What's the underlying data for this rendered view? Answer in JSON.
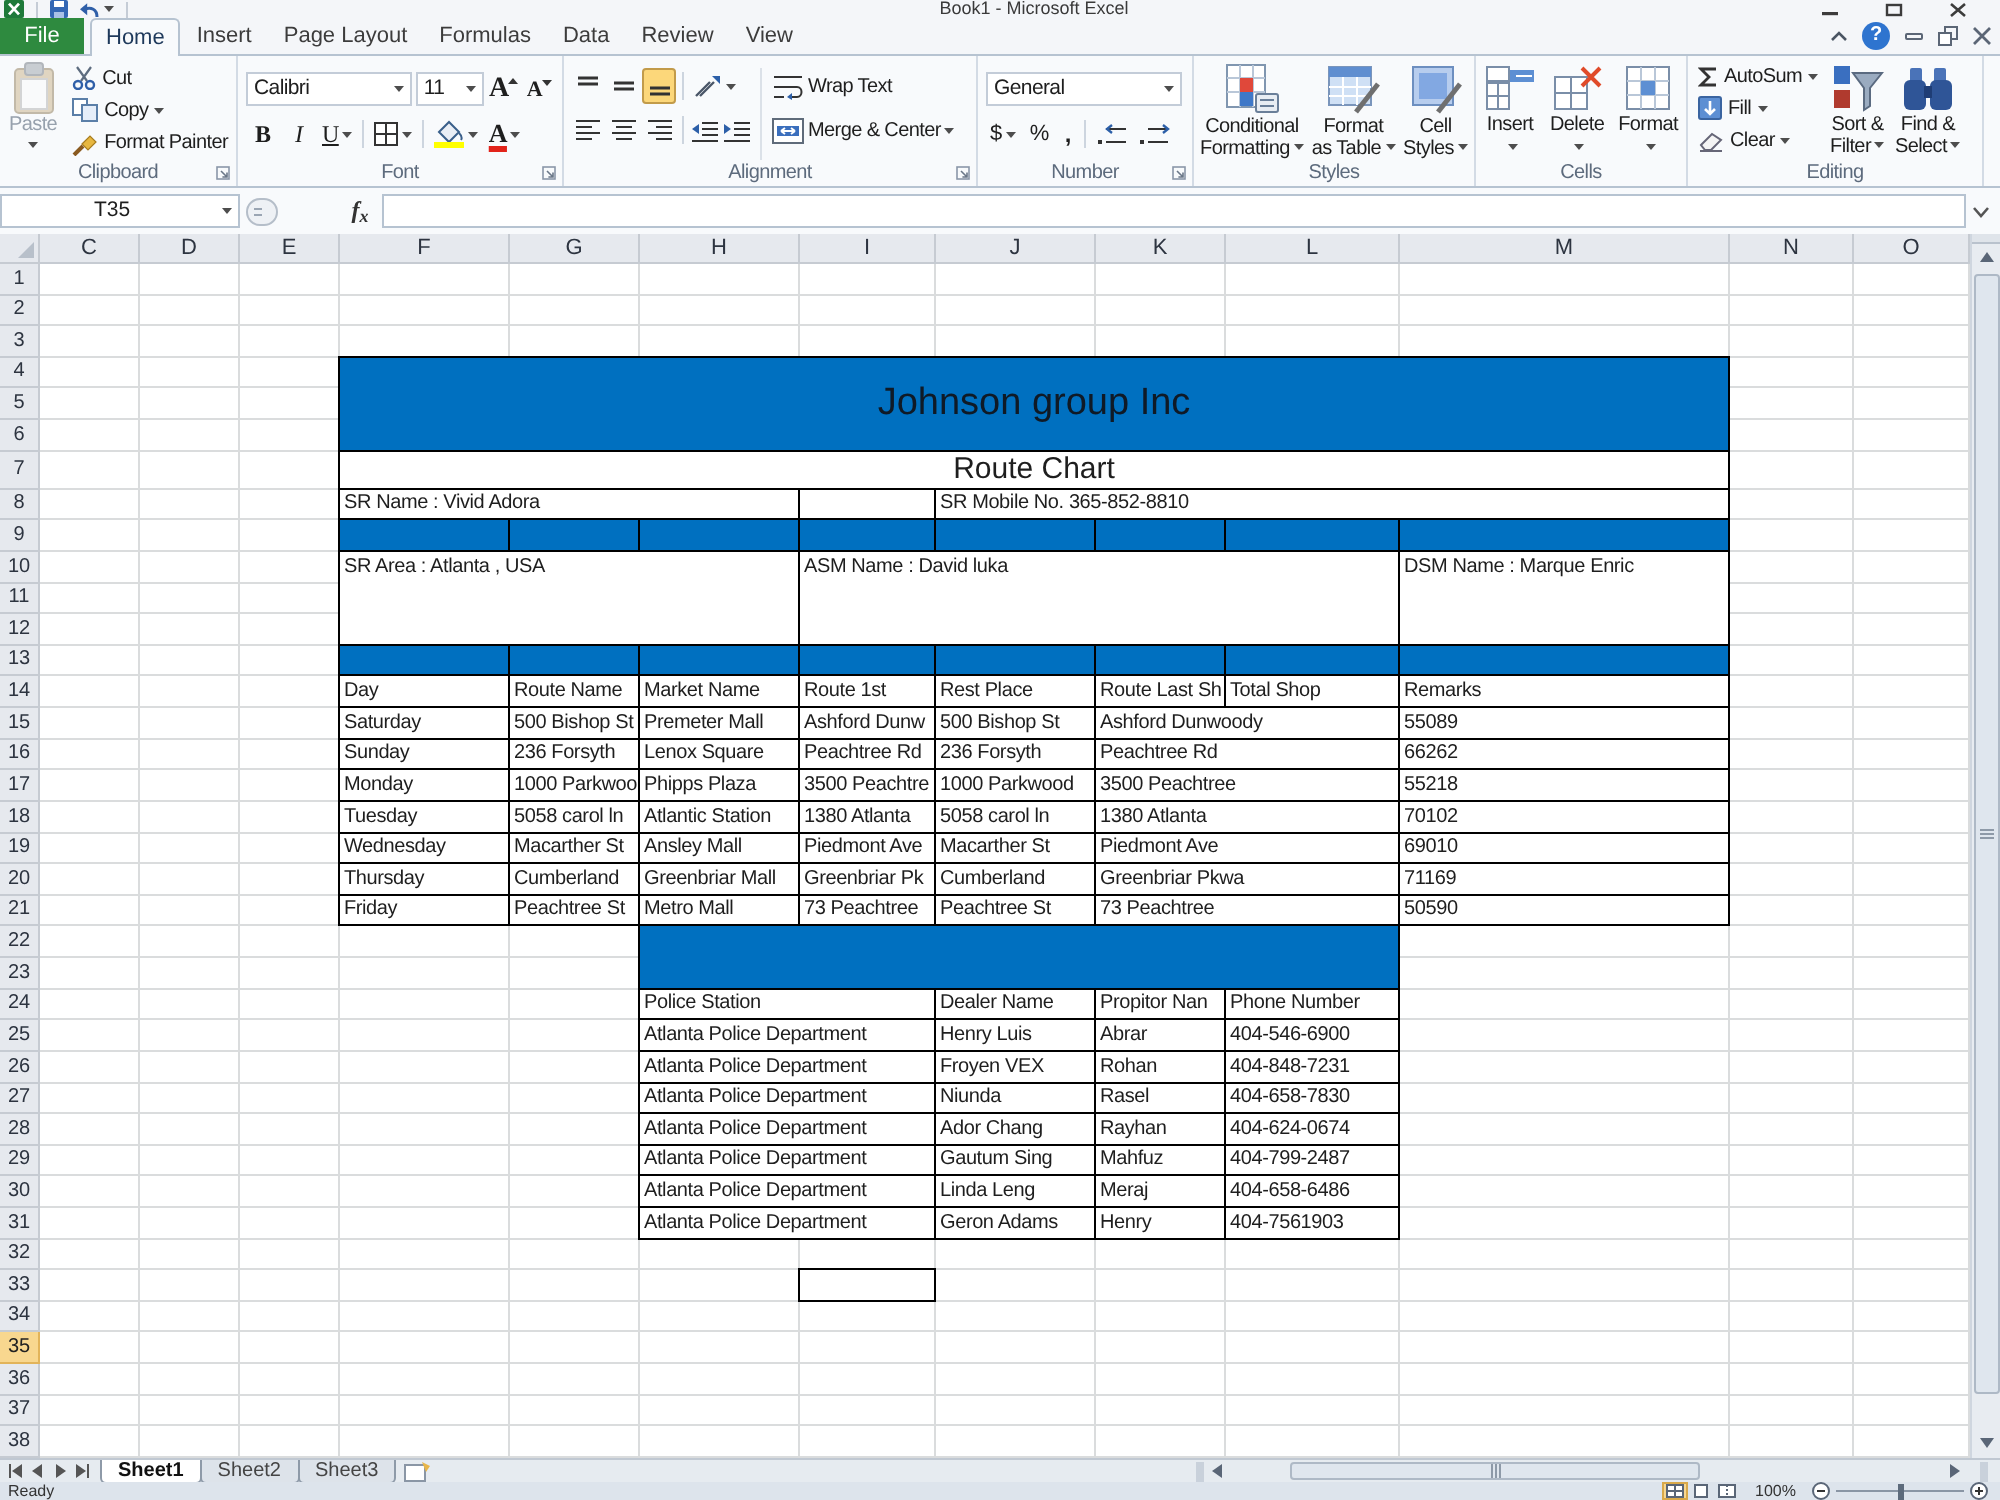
{
  "window": {
    "title": "Book1 - Microsoft Excel"
  },
  "ribbon_tabs": [
    {
      "label": "File",
      "kind": "file",
      "selected": false
    },
    {
      "label": "Home",
      "kind": "tab",
      "selected": true
    },
    {
      "label": "Insert",
      "kind": "tab",
      "selected": false
    },
    {
      "label": "Page Layout",
      "kind": "tab",
      "selected": false
    },
    {
      "label": "Formulas",
      "kind": "tab",
      "selected": false
    },
    {
      "label": "Data",
      "kind": "tab",
      "selected": false
    },
    {
      "label": "Review",
      "kind": "tab",
      "selected": false
    },
    {
      "label": "View",
      "kind": "tab",
      "selected": false
    }
  ],
  "help": "?",
  "ribbon": {
    "clipboard": {
      "label": "Clipboard",
      "paste": {
        "label": "Paste",
        "disabled": true
      },
      "cut": "Cut",
      "copy": "Copy",
      "format_painter": "Format Painter"
    },
    "font": {
      "label": "Font",
      "font_name": "Calibri",
      "font_size": "11",
      "grow": "A",
      "shrink": "A",
      "bold": "B",
      "italic": "I",
      "underline": "U",
      "font_color": "A"
    },
    "alignment": {
      "label": "Alignment",
      "vertical": [
        {
          "kind": "top",
          "selected": false
        },
        {
          "kind": "middle",
          "selected": false
        },
        {
          "kind": "bottom",
          "selected": true
        }
      ],
      "horizontal": [
        {
          "kind": "left",
          "selected": false
        },
        {
          "kind": "center",
          "selected": false
        },
        {
          "kind": "right",
          "selected": false
        }
      ],
      "wrap_text": "Wrap Text",
      "merge_center": "Merge & Center"
    },
    "number": {
      "label": "Number",
      "format": "General",
      "currency": "$",
      "percent": "%",
      "comma": ","
    },
    "styles": {
      "label": "Styles",
      "buttons": [
        {
          "kind": "conditional",
          "lines": [
            "Conditional",
            "Formatting"
          ]
        },
        {
          "kind": "table",
          "lines": [
            "Format",
            "as Table"
          ]
        },
        {
          "kind": "cell_styles",
          "lines": [
            "Cell",
            "Styles"
          ]
        }
      ]
    },
    "cells": {
      "label": "Cells",
      "buttons": [
        {
          "kind": "insert",
          "label": "Insert"
        },
        {
          "kind": "delete",
          "label": "Delete"
        },
        {
          "kind": "format",
          "label": "Format"
        }
      ]
    },
    "editing": {
      "label": "Editing",
      "autosum": "AutoSum",
      "fill": "Fill",
      "clear": "Clear",
      "sort_filter": [
        "Sort &",
        "Filter"
      ],
      "find_select": [
        "Find &",
        "Select"
      ]
    }
  },
  "formula_bar": {
    "name_box": "T35",
    "insert_function": "f$_{x}$"
  },
  "sheet": {
    "columns": [
      {
        "label": "C",
        "selected": false
      },
      {
        "label": "D",
        "selected": false
      },
      {
        "label": "E",
        "selected": false
      },
      {
        "label": "F",
        "selected": false
      },
      {
        "label": "G",
        "selected": false
      },
      {
        "label": "H",
        "selected": false
      },
      {
        "label": "I",
        "selected": false
      },
      {
        "label": "J",
        "selected": false
      },
      {
        "label": "K",
        "selected": false
      },
      {
        "label": "L",
        "selected": false
      },
      {
        "label": "M",
        "selected": false
      },
      {
        "label": "N",
        "selected": false
      },
      {
        "label": "O",
        "selected": false
      }
    ],
    "rows": [
      {
        "label": "1",
        "selected": false
      },
      {
        "label": "2",
        "selected": false
      },
      {
        "label": "3",
        "selected": false
      },
      {
        "label": "4",
        "selected": false
      },
      {
        "label": "5",
        "selected": false
      },
      {
        "label": "6",
        "selected": false
      },
      {
        "label": "7",
        "selected": false
      },
      {
        "label": "8",
        "selected": false
      },
      {
        "label": "9",
        "selected": false
      },
      {
        "label": "10",
        "selected": false
      },
      {
        "label": "11",
        "selected": false
      },
      {
        "label": "12",
        "selected": false
      },
      {
        "label": "13",
        "selected": false
      },
      {
        "label": "14",
        "selected": false
      },
      {
        "label": "15",
        "selected": false
      },
      {
        "label": "16",
        "selected": false
      },
      {
        "label": "17",
        "selected": false
      },
      {
        "label": "18",
        "selected": false
      },
      {
        "label": "19",
        "selected": false
      },
      {
        "label": "20",
        "selected": false
      },
      {
        "label": "21",
        "selected": false
      },
      {
        "label": "22",
        "selected": false
      },
      {
        "label": "23",
        "selected": false
      },
      {
        "label": "24",
        "selected": false
      },
      {
        "label": "25",
        "selected": false
      },
      {
        "label": "26",
        "selected": false
      },
      {
        "label": "27",
        "selected": false
      },
      {
        "label": "28",
        "selected": false
      },
      {
        "label": "29",
        "selected": false
      },
      {
        "label": "30",
        "selected": false
      },
      {
        "label": "31",
        "selected": false
      },
      {
        "label": "32",
        "selected": false
      },
      {
        "label": "33",
        "selected": false
      },
      {
        "label": "34",
        "selected": false
      },
      {
        "label": "35",
        "selected": true
      },
      {
        "label": "36",
        "selected": false
      },
      {
        "label": "37",
        "selected": false
      },
      {
        "label": "38",
        "selected": false
      }
    ],
    "company": "Johnson group Inc",
    "chart_title": "Route Chart",
    "sr_name": "SR Name : Vivid Adora",
    "sr_mobile": "SR Mobile No. 365-852-8810",
    "sr_area": "SR Area : Atlanta , USA",
    "asm_name": "ASM Name : David luka",
    "dsm_name": "DSM Name : Marque Enric",
    "route_table": {
      "columns": [
        "Day",
        "Route Name",
        "Market Name",
        "Route 1st",
        "Rest Place",
        "Route Last Sh",
        "Total Shop",
        "Remarks"
      ],
      "rows": [
        [
          "Saturday",
          "500 Bishop St",
          "Premeter Mall",
          "Ashford Dunw",
          "500 Bishop St",
          "Ashford Dunwoody",
          "55089"
        ],
        [
          "Sunday",
          "236 Forsyth",
          "Lenox Square",
          "Peachtree Rd",
          "236 Forsyth",
          "Peachtree Rd",
          "66262"
        ],
        [
          "Monday",
          "1000 Parkwoo",
          "Phipps Plaza",
          "3500 Peachtre",
          "1000 Parkwood",
          "3500 Peachtree",
          "55218"
        ],
        [
          "Tuesday",
          "5058 carol ln",
          "Atlantic Station",
          "1380 Atlanta",
          "5058 carol ln",
          "1380 Atlanta",
          "70102"
        ],
        [
          "Wednesday",
          "Macarther St",
          "Ansley Mall",
          "Piedmont Ave",
          "Macarther St",
          "Piedmont Ave",
          "69010"
        ],
        [
          "Thursday",
          "Cumberland",
          "Greenbriar Mall",
          "Greenbriar Pk",
          "Cumberland",
          "Greenbriar Pkwa",
          "71169"
        ],
        [
          "Friday",
          "Peachtree St",
          "Metro Mall",
          "73 Peachtree",
          "Peachtree St",
          "73 Peachtree",
          "50590"
        ]
      ]
    },
    "dealer_table": {
      "columns": [
        "Police Station",
        "Dealer Name",
        "Propitor Nan",
        "Phone Number"
      ],
      "rows": [
        [
          "Atlanta Police Department",
          "Henry Luis",
          "Abrar",
          "404-546-6900"
        ],
        [
          "Atlanta Police Department",
          "Froyen VEX",
          "Rohan",
          "404-848-7231"
        ],
        [
          "Atlanta Police Department",
          "Niunda",
          "Rasel",
          "404-658-7830"
        ],
        [
          "Atlanta Police Department",
          "Ador Chang",
          "Rayhan",
          "404-624-0674"
        ],
        [
          "Atlanta Police Department",
          "Gautum Sing",
          "Mahfuz",
          "404-799-2487"
        ],
        [
          "Atlanta Police Department",
          "Linda Leng",
          "Meraj",
          "404-658-6486"
        ],
        [
          "Atlanta Police Department",
          "Geron Adams",
          "Henry",
          "404-7561903"
        ]
      ]
    }
  },
  "sheet_tabs": [
    {
      "label": "Sheet1",
      "selected": true
    },
    {
      "label": "Sheet2",
      "selected": false
    },
    {
      "label": "Sheet3",
      "selected": false
    }
  ],
  "status_bar": {
    "status": "Ready",
    "views": [
      {
        "kind": "normal",
        "selected": true
      },
      {
        "kind": "page_layout",
        "selected": false
      },
      {
        "kind": "page_break",
        "selected": false
      }
    ],
    "zoom": "100%",
    "zoom_slider": {
      "level": 0.5
    }
  }
}
